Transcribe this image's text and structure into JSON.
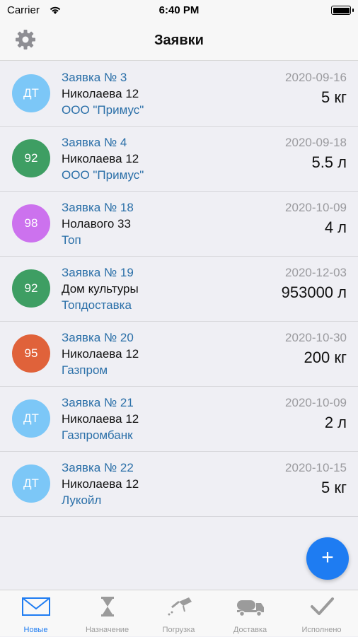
{
  "status_bar": {
    "carrier": "Carrier",
    "time": "6:40 PM"
  },
  "nav": {
    "title": "Заявки",
    "settings_icon": "gear-icon"
  },
  "requests": [
    {
      "fuel": "ДТ",
      "color": "#7cc7f7",
      "title": "Заявка № 3",
      "address": "Николаева 12",
      "company": "ООО \"Примус\"",
      "date": "2020-09-16",
      "amount": "5 кг"
    },
    {
      "fuel": "92",
      "color": "#3e9e63",
      "title": "Заявка № 4",
      "address": "Николаева 12",
      "company": "ООО \"Примус\"",
      "date": "2020-09-18",
      "amount": "5.5 л"
    },
    {
      "fuel": "98",
      "color": "#cc72ee",
      "title": "Заявка № 18",
      "address": "Нолавого 33",
      "company": "Топ",
      "date": "2020-10-09",
      "amount": "4 л"
    },
    {
      "fuel": "92",
      "color": "#3e9e63",
      "title": "Заявка № 19",
      "address": "Дом культуры",
      "company": "Топдоставка",
      "date": "2020-12-03",
      "amount": "953000 л"
    },
    {
      "fuel": "95",
      "color": "#e0623a",
      "title": "Заявка № 20",
      "address": "Николаева 12",
      "company": "Газпром",
      "date": "2020-10-30",
      "amount": "200 кг"
    },
    {
      "fuel": "ДТ",
      "color": "#7cc7f7",
      "title": "Заявка № 21",
      "address": "Николаева 12",
      "company": "Газпромбанк",
      "date": "2020-10-09",
      "amount": "2 л"
    },
    {
      "fuel": "ДТ",
      "color": "#7cc7f7",
      "title": "Заявка № 22",
      "address": "Николаева 12",
      "company": "Лукойл",
      "date": "2020-10-15",
      "amount": "5 кг"
    }
  ],
  "fab": {
    "label": "+",
    "icon": "plus-icon"
  },
  "tabs": [
    {
      "label": "Новые",
      "icon": "envelope-icon",
      "active": true
    },
    {
      "label": "Назначение",
      "icon": "hourglass-icon",
      "active": false
    },
    {
      "label": "Погрузка",
      "icon": "fuel-nozzle-icon",
      "active": false
    },
    {
      "label": "Доставка",
      "icon": "tanker-truck-icon",
      "active": false
    },
    {
      "label": "Исполнено",
      "icon": "checkmark-icon",
      "active": false
    }
  ],
  "colors": {
    "accent": "#1e7cf2",
    "link": "#2a6fa8",
    "inactive_tab": "#9b9b9b"
  }
}
